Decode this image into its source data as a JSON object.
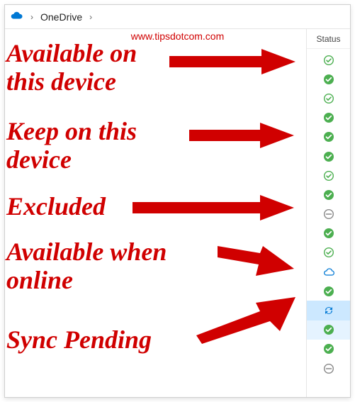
{
  "breadcrumb": {
    "root_label": "OneDrive"
  },
  "watermark": "www.tipsdotcom.com",
  "status_header": "Status",
  "status_rows": [
    {
      "type": "outline_check"
    },
    {
      "type": "solid_check"
    },
    {
      "type": "outline_check"
    },
    {
      "type": "solid_check"
    },
    {
      "type": "solid_check"
    },
    {
      "type": "solid_check"
    },
    {
      "type": "outline_check"
    },
    {
      "type": "solid_check"
    },
    {
      "type": "excluded"
    },
    {
      "type": "solid_check"
    },
    {
      "type": "outline_check"
    },
    {
      "type": "cloud"
    },
    {
      "type": "solid_check"
    },
    {
      "type": "sync",
      "row_state": "selected"
    },
    {
      "type": "solid_check",
      "row_state": "hover"
    },
    {
      "type": "solid_check"
    },
    {
      "type": "excluded"
    }
  ],
  "annotations": {
    "a1": {
      "line1": "Available on",
      "line2": "this device"
    },
    "a2": {
      "line1": "Keep on this",
      "line2": "device"
    },
    "a3": {
      "line1": "Excluded"
    },
    "a4": {
      "line1": "Available when",
      "line2": "online"
    },
    "a5": {
      "line1": "Sync Pending"
    }
  },
  "colors": {
    "annotation": "#d00000",
    "solid_check": "#4caf50",
    "outline_check": "#4caf50",
    "cloud": "#0078d4",
    "sync": "#0078d4",
    "excluded": "#888"
  }
}
